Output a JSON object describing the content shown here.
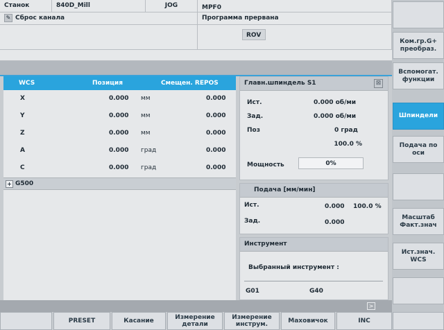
{
  "header": {
    "machine_label": "Станок",
    "channel_name": "840D_Mill",
    "mode": "JOG",
    "program_name": "MPF0",
    "reset_text": "Сброс канала",
    "program_status": "Программа прервана",
    "rov": "ROV"
  },
  "wcs_table": {
    "headers": [
      "WCS",
      "Позиция",
      "Смещен. REPOS"
    ],
    "rows": [
      {
        "axis": "X",
        "pos": "0.000",
        "unit": "мм",
        "offset": "0.000"
      },
      {
        "axis": "Y",
        "pos": "0.000",
        "unit": "мм",
        "offset": "0.000"
      },
      {
        "axis": "Z",
        "pos": "0.000",
        "unit": "мм",
        "offset": "0.000"
      },
      {
        "axis": "A",
        "pos": "0.000",
        "unit": "град",
        "offset": "0.000"
      },
      {
        "axis": "C",
        "pos": "0.000",
        "unit": "град",
        "offset": "0.000"
      }
    ],
    "g_code": "G500"
  },
  "spindle": {
    "title": "Главн.шпиндель  S1",
    "act_label": "Ист.",
    "act_value": "0.000 об/ми",
    "set_label": "Зад.",
    "set_value": "0.000 об/ми",
    "pos_label": "Поз",
    "pos_value": "0 град",
    "override": "100.0 %",
    "power_label": "Мощность",
    "power_value": "0%"
  },
  "feed": {
    "title": "Подача [мм/мин]",
    "act_label": "Ист.",
    "act_value": "0.000",
    "act_override": "100.0 %",
    "set_label": "Зад.",
    "set_value": "0.000"
  },
  "tool": {
    "title": "Инструмент",
    "selected_label": "Выбранный инструмент :",
    "g1": "G01",
    "g2": "G40"
  },
  "vsoftkeys": [
    "",
    "Ком.гр.G+ преобраз.",
    "Вспомогат. функции",
    "Шпиндели",
    "Подача по оси",
    "",
    "Масштаб Факт.знач",
    "Ист.знач. WCS",
    "",
    ""
  ],
  "hsoftkeys": [
    "",
    "PRESET",
    "Касание",
    "Измерение детали",
    "Измерение инструм.",
    "Маховичок",
    "INC",
    ""
  ],
  "colors": {
    "accent": "#2aa4dd",
    "panel": "#e6e8ea",
    "frame": "#c8ccd0"
  }
}
